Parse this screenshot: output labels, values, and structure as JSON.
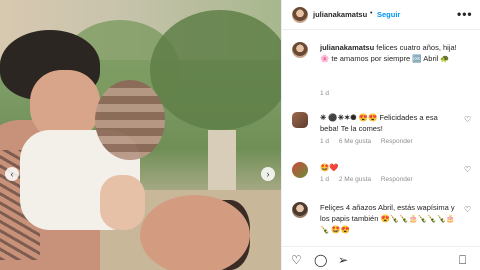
{
  "header": {
    "username": "julianakamatsu",
    "separator": "•",
    "follow_label": "Seguir",
    "more_label": "•••"
  },
  "caption": {
    "username": "julianakamatsu",
    "text": " felices cuatro años, hija! 🌸 te amamos por siempre 🆒 Abril 🐢",
    "time": "1 d"
  },
  "comments": [
    {
      "username": "✳ ⚫✳✶✺",
      "text": " 😍😍 Felicidades a esa beba! Te la comes!",
      "time": "1 d",
      "likes": "6 Me gusta",
      "reply": "Responder"
    },
    {
      "username": "",
      "text": "🤩❤️",
      "time": "1 d",
      "likes": "2 Me gusta",
      "reply": "Responder"
    },
    {
      "username": "",
      "text": "Feliçes 4 añazos Abril, estás wapísima y los papis también 😍🍾🍾🎂🍾🍾🍾🎂🍾 🤩😍",
      "time": "",
      "likes": "",
      "reply": ""
    }
  ],
  "photo": {
    "prev_label": "‹",
    "next_label": "›"
  },
  "actions": {
    "like": "♡",
    "comment": "◯",
    "share": "➢",
    "save": "⎕"
  },
  "colors": {
    "accent": "#0095f6",
    "secondary_text": "#8e8e8e",
    "border": "#efefef"
  }
}
